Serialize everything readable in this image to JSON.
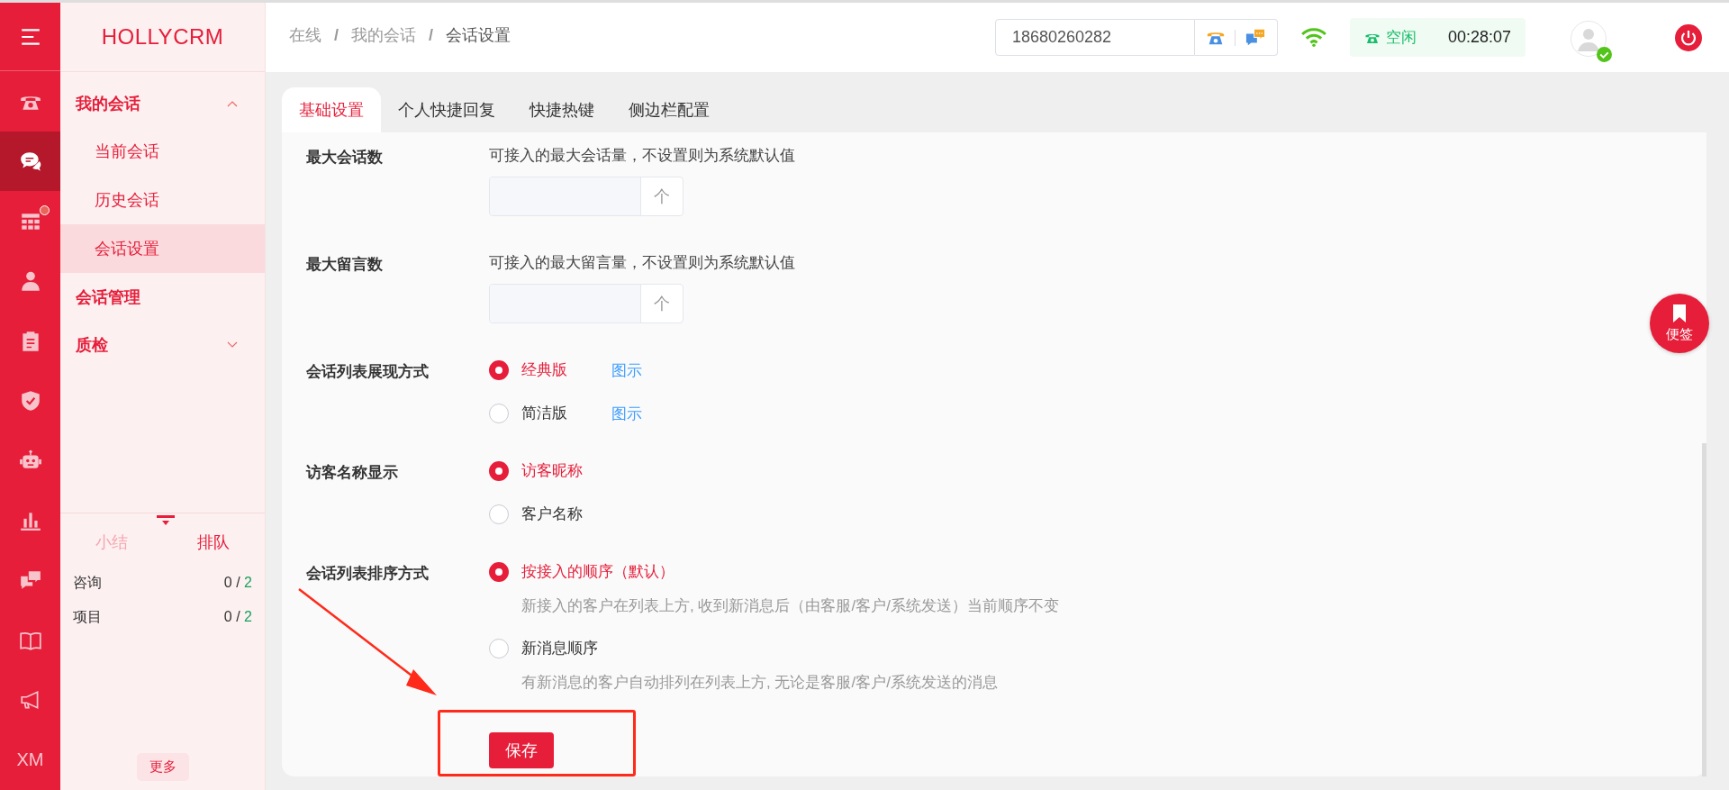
{
  "rail": {
    "items": [
      {
        "kind": "menu",
        "selected": false,
        "dot": false
      },
      {
        "kind": "phone",
        "selected": false,
        "dot": false
      },
      {
        "kind": "chat",
        "selected": true,
        "dot": false
      },
      {
        "kind": "grid",
        "selected": false,
        "dot": true
      },
      {
        "kind": "person",
        "selected": false,
        "dot": false
      },
      {
        "kind": "clipboard",
        "selected": false,
        "dot": false
      },
      {
        "kind": "shield",
        "selected": false,
        "dot": false
      },
      {
        "kind": "robot",
        "selected": false,
        "dot": false
      },
      {
        "kind": "chart",
        "selected": false,
        "dot": false
      },
      {
        "kind": "messages",
        "selected": false,
        "dot": false
      },
      {
        "kind": "book",
        "selected": false,
        "dot": false
      },
      {
        "kind": "megaphone",
        "selected": false,
        "dot": false
      },
      {
        "kind": "text",
        "selected": false,
        "dot": false,
        "label": "XM"
      }
    ]
  },
  "logo": "HOLLYCRM",
  "nav": [
    {
      "label": "我的会话",
      "kind": "group",
      "expanded": true,
      "children": [
        {
          "label": "当前会话",
          "selected": false
        },
        {
          "label": "历史会话",
          "selected": false
        },
        {
          "label": "会话设置",
          "selected": true
        }
      ]
    },
    {
      "label": "会话管理",
      "kind": "link"
    },
    {
      "label": "质检",
      "kind": "group",
      "expanded": false
    }
  ],
  "queue_panel": {
    "tabs": [
      {
        "label": "小结",
        "selected": false
      },
      {
        "label": "排队",
        "selected": true
      }
    ],
    "rows": [
      {
        "label": "咨询",
        "count": "0",
        "total": "2"
      },
      {
        "label": "项目",
        "count": "0",
        "total": "2"
      }
    ],
    "separator": "/",
    "more_button": "更多"
  },
  "breadcrumb_separator": "/",
  "breadcrumb": [
    "在线",
    "我的会话",
    "会话设置"
  ],
  "phone_field": {
    "value": "18680260282"
  },
  "status": {
    "label": "空闲",
    "timer": "00:28:07"
  },
  "tabs": [
    {
      "label": "基础设置",
      "selected": true
    },
    {
      "label": "个人快捷回复",
      "selected": false
    },
    {
      "label": "快捷热键",
      "selected": false
    },
    {
      "label": "侧边栏配置",
      "selected": false
    }
  ],
  "settings": [
    {
      "kind": "number",
      "label": "最大会话数",
      "hint": "可接入的最大会话量，不设置则为系统默认值",
      "unit": "个"
    },
    {
      "kind": "number",
      "label": "最大留言数",
      "hint": "可接入的最大留言量，不设置则为系统默认值",
      "unit": "个"
    },
    {
      "kind": "radio",
      "label": "会话列表展现方式",
      "options": [
        {
          "label": "经典版",
          "selected": true,
          "link": "图示"
        },
        {
          "label": "简洁版",
          "selected": false,
          "link": "图示"
        }
      ]
    },
    {
      "kind": "radio",
      "label": "访客名称显示",
      "options": [
        {
          "label": "访客昵称",
          "selected": true
        },
        {
          "label": "客户名称",
          "selected": false
        }
      ]
    },
    {
      "kind": "radio",
      "label": "会话列表排序方式",
      "options": [
        {
          "label": "按接入的顺序（默认）",
          "selected": true,
          "description": "新接入的客户在列表上方, 收到新消息后（由客服/客户/系统发送）当前顺序不变"
        },
        {
          "label": "新消息顺序",
          "selected": false,
          "description": "有新消息的客户自动排列在列表上方, 无论是客服/客户/系统发送的消息"
        }
      ]
    }
  ],
  "save_button": "保存",
  "note_button": "便签"
}
